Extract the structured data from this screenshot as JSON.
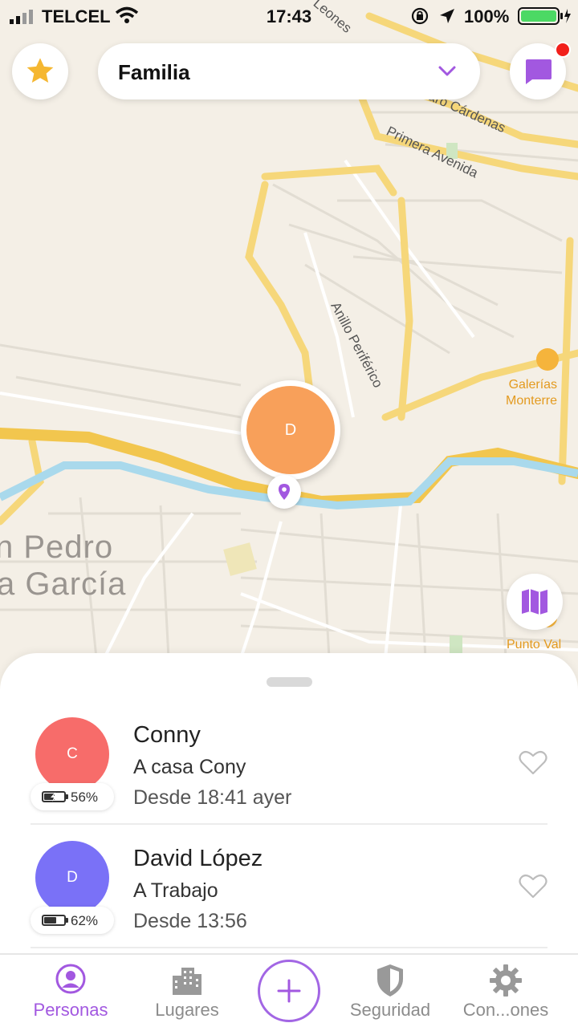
{
  "status_bar": {
    "carrier": "TELCEL",
    "time": "17:43",
    "battery": "100%"
  },
  "header": {
    "group_name": "Familia"
  },
  "map": {
    "labels": {
      "pedro": "n Pedro",
      "garcia": "a García",
      "cardenas": "aro Cárdenas",
      "primera": "Primera Avenida",
      "anillo": "Anillo Periférico",
      "galerias_1": "Galerías",
      "galerias_2": "Monterre",
      "punto": "Punto Val",
      "leones": "Leones"
    },
    "pin_initial": "D"
  },
  "people": [
    {
      "initial": "C",
      "name": "Conny",
      "place": "A casa Cony",
      "since": "Desde 18:41 ayer",
      "battery": "56%",
      "battery_level": 0.56,
      "charging": true,
      "avatar_color": "#f76c6a"
    },
    {
      "initial": "D",
      "name": "David López",
      "place": "A Trabajo",
      "since": "Desde 13:56",
      "battery": "62%",
      "battery_level": 0.62,
      "charging": false,
      "avatar_color": "#7a71f7"
    }
  ],
  "tabs": [
    {
      "label": "Personas",
      "icon": "person-icon",
      "active": true
    },
    {
      "label": "Lugares",
      "icon": "buildings-icon",
      "active": false
    },
    {
      "label": "Seguridad",
      "icon": "shield-icon",
      "active": false
    },
    {
      "label": "Con...ones",
      "icon": "gear-icon",
      "active": false
    }
  ],
  "colors": {
    "accent": "#a258e0",
    "pin": "#f8a05a",
    "star": "#f5b731",
    "road": "#f6d77a",
    "river": "#a9d9ec"
  }
}
